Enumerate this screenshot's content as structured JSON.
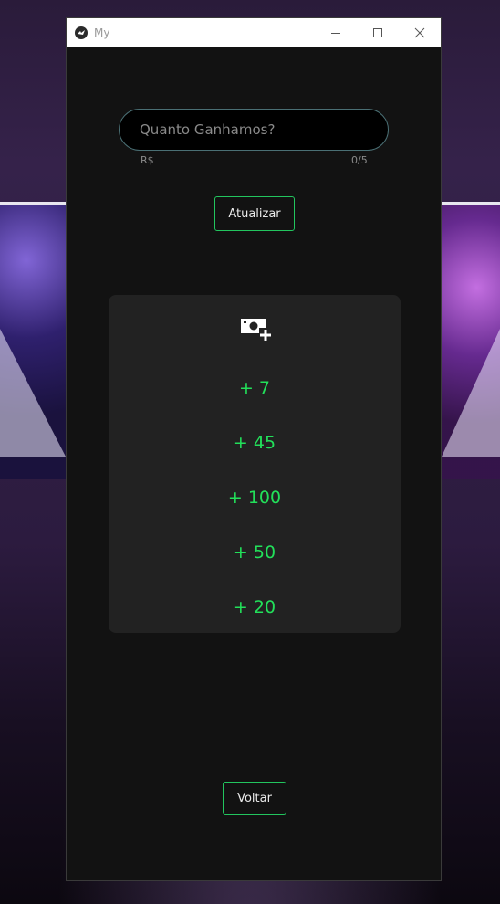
{
  "window": {
    "title": "My"
  },
  "form": {
    "placeholder": "Quanto Ganhamos?",
    "value": "",
    "prefix_hint": "R$",
    "counter": "0/5"
  },
  "buttons": {
    "update_label": "Atualizar",
    "back_label": "Voltar"
  },
  "earnings": {
    "icon": "money-add-icon",
    "items": [
      "+ 7",
      "+ 45",
      "+ 100",
      "+ 50",
      "+ 20"
    ]
  },
  "colors": {
    "accent": "#22e05a",
    "button_border": "#22c55e",
    "window_bg": "#121212",
    "card_bg": "#222222"
  }
}
